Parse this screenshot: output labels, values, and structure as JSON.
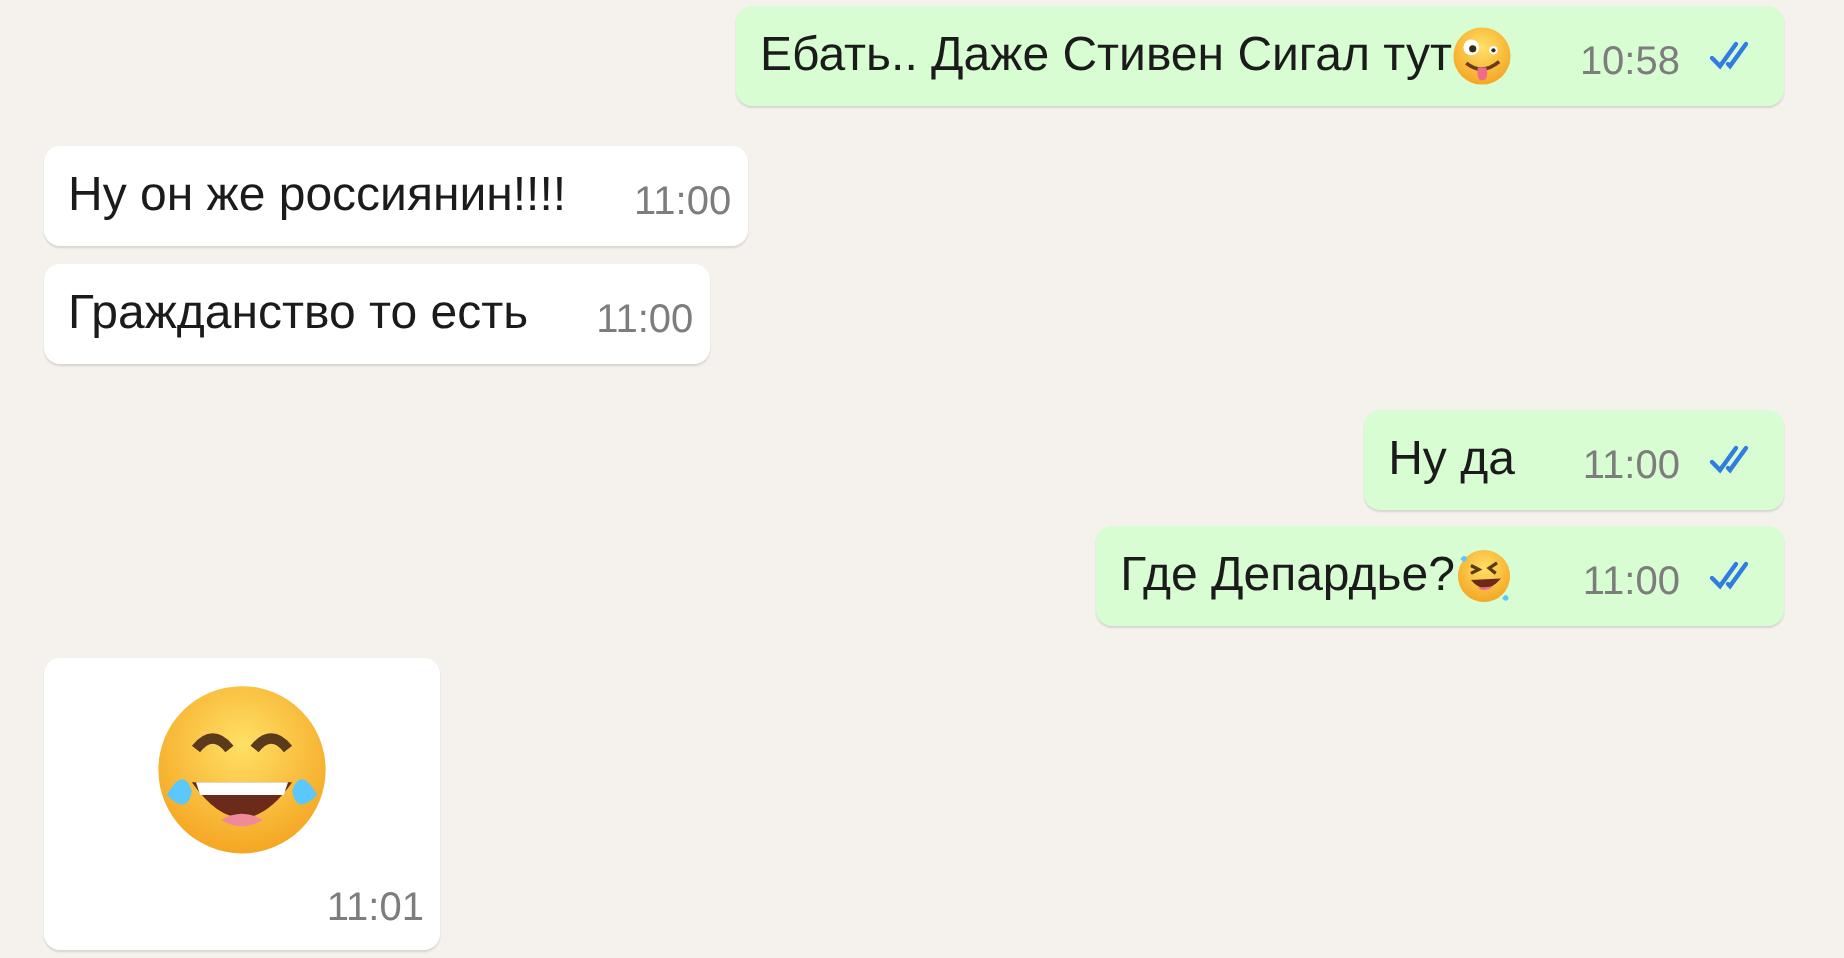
{
  "messages": [
    {
      "kind": "outgoing",
      "text": "Ебать.. Даже Стивен Сигал тут",
      "emoji": {
        "kind": "zany"
      },
      "time": "10:58",
      "read": true
    },
    {
      "kind": "incoming",
      "text": "Ну он же россиянин!!!!",
      "time": "11:00"
    },
    {
      "kind": "incoming",
      "text": "Гражданство то есть",
      "time": "11:00"
    },
    {
      "kind": "outgoing",
      "text": "Ну да",
      "time": "11:00",
      "read": true
    },
    {
      "kind": "outgoing",
      "text": "Где Депардье?",
      "emoji": {
        "kind": "rofl"
      },
      "time": "11:00",
      "read": true
    },
    {
      "kind": "sticker",
      "emoji": {
        "kind": "joy"
      },
      "time": "11:01"
    }
  ]
}
